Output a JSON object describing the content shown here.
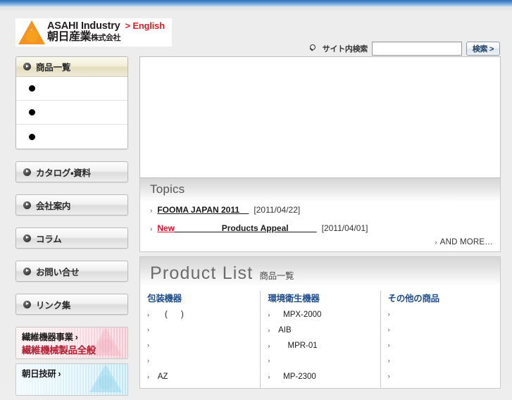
{
  "header": {
    "logo": {
      "mark_name": "asahi-a-mark",
      "english_name": "ASAHI Industry",
      "english_link": "> English",
      "japanese_name_main": "朝日産業",
      "japanese_name_suffix": "株式会社"
    },
    "search": {
      "icon": "search-icon",
      "label": "サイト内検索",
      "value": "",
      "placeholder": "",
      "button_label": "検索 >"
    }
  },
  "sidebar": {
    "products_group": {
      "header_label": "商品一覧",
      "items": [
        {
          "label": ""
        },
        {
          "label": ""
        },
        {
          "label": ""
        }
      ]
    },
    "buttons": [
      {
        "label": "カタログ・資料",
        "name": "catalog"
      },
      {
        "label": "会社案内",
        "name": "company"
      },
      {
        "label": "コラム",
        "name": "column"
      },
      {
        "label": "お問い合せ",
        "name": "contact"
      },
      {
        "label": "リンク集",
        "name": "links"
      }
    ],
    "banners": [
      {
        "name": "fiber-business",
        "line1": "繊維機器事業",
        "chevron": "›",
        "line2": "繊維機械製品全般"
      },
      {
        "name": "asahi-giken",
        "line1": "朝日技研",
        "chevron": "›",
        "line2": ""
      }
    ]
  },
  "content": {
    "hero": {
      "name": "hero-banner",
      "alt": ""
    },
    "topics": {
      "title": "Topics",
      "rows": [
        {
          "chevron": "›",
          "link_text": "FOOMA JAPAN 2011    ",
          "is_new": false,
          "date": "[2011/04/22]"
        },
        {
          "chevron": "›",
          "new_label": "New",
          "link_text": "                    Products Appeal            ",
          "is_new": true,
          "date": "[2011/04/01]"
        }
      ],
      "and_more": {
        "chevron": "›",
        "label": "AND MORE…"
      }
    },
    "product_list": {
      "title_en": "Product List",
      "title_jp": "商品一覧",
      "columns": [
        {
          "title": "包装機器",
          "items": [
            {
              "chevron": "›",
              "label": "     (      )"
            },
            {
              "chevron": "›",
              "label": ""
            },
            {
              "chevron": "›",
              "label": ""
            },
            {
              "chevron": "›",
              "label": ""
            },
            {
              "chevron": "›",
              "label": "  AZ"
            }
          ]
        },
        {
          "title": "環境衛生機器",
          "items": [
            {
              "chevron": "›",
              "label": "    MPX-2000"
            },
            {
              "chevron": "›",
              "label": "  AIB"
            },
            {
              "chevron": "›",
              "label": "      MPR-01"
            },
            {
              "chevron": "›",
              "label": ""
            },
            {
              "chevron": "›",
              "label": "    MP-2300"
            }
          ]
        },
        {
          "title": "その他の商品",
          "items": [
            {
              "chevron": "›",
              "label": ""
            },
            {
              "chevron": "›",
              "label": ""
            },
            {
              "chevron": "›",
              "label": ""
            },
            {
              "chevron": "›",
              "label": ""
            },
            {
              "chevron": "›",
              "label": ""
            }
          ]
        }
      ]
    }
  }
}
